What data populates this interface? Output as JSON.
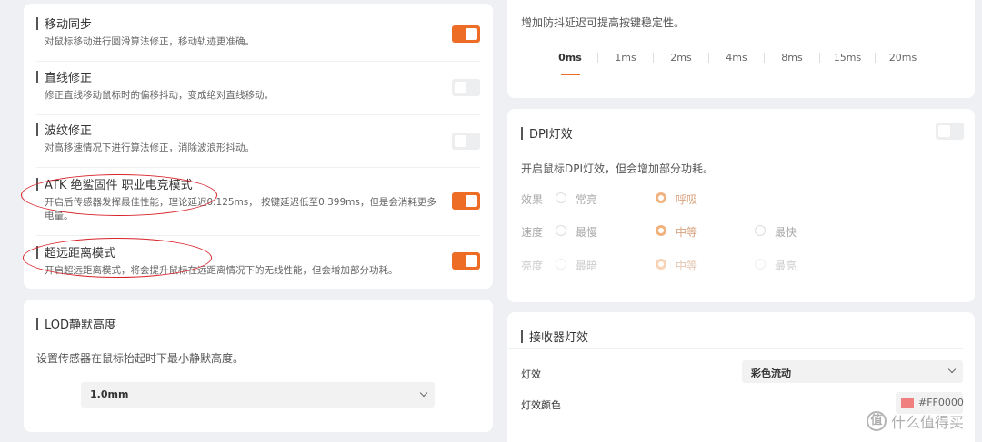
{
  "left": {
    "rows": [
      {
        "title": "移动同步",
        "desc": "对鼠标移动进行圆滑算法修正，移动轨迹更准确。",
        "on": true
      },
      {
        "title": "直线修正",
        "desc": "修正直线移动鼠标时的偏移抖动，变成绝对直线移动。",
        "on": false
      },
      {
        "title": "波纹修正",
        "desc": "对高移速情况下进行算法修正，消除波浪形抖动。",
        "on": false
      },
      {
        "title": "ATK 绝鲨固件 职业电竞模式",
        "desc": "开启后传感器发挥最佳性能，理论延迟0.125ms， 按键延迟低至0.399ms，但是会消耗更多电量。",
        "on": true
      },
      {
        "title": "超远距离模式",
        "desc": "开启超远距离模式，将会提升鼠标在远距离情况下的无线性能，但会增加部分功耗。",
        "on": true
      }
    ],
    "lod": {
      "title": "LOD静默高度",
      "desc": "设置传感器在鼠标抬起时下最小静默高度。",
      "value": "1.0mm"
    }
  },
  "debounce": {
    "desc": "增加防抖延迟可提高按键稳定性。",
    "tabs": [
      "0ms",
      "1ms",
      "2ms",
      "4ms",
      "8ms",
      "15ms",
      "20ms"
    ],
    "active": "0ms"
  },
  "dpi": {
    "title": "DPI灯效",
    "on": false,
    "desc": "开启鼠标DPI灯效，但会增加部分功耗。",
    "rows": [
      {
        "label": "效果",
        "options": [
          "常亮",
          "呼吸"
        ],
        "selected": "呼吸"
      },
      {
        "label": "速度",
        "options": [
          "最慢",
          "中等",
          "最快"
        ],
        "selected": "中等"
      },
      {
        "label": "亮度",
        "options": [
          "最暗",
          "中等",
          "最亮"
        ],
        "selected": "中等"
      }
    ]
  },
  "receiver": {
    "title": "接收器灯效",
    "effect_label": "灯效",
    "effect_value": "彩色流动",
    "color_label": "灯效颜色",
    "color_value": "#FF0000",
    "swatch": "#f08080"
  },
  "watermark": "什么值得买",
  "accent": "#ee6d26"
}
